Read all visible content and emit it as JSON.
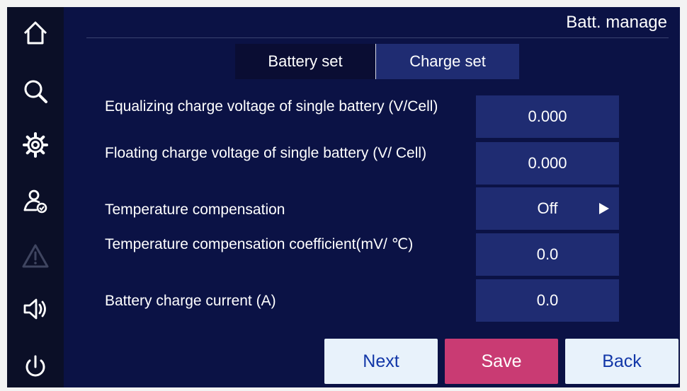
{
  "header": {
    "title": "Batt. manage"
  },
  "tabs": [
    {
      "label": "Battery set"
    },
    {
      "label": "Charge set"
    }
  ],
  "rows": [
    {
      "label": "Equalizing charge voltage of single battery (V/Cell)",
      "value": "0.000"
    },
    {
      "label": "Floating charge voltage of single battery (V/ Cell)",
      "value": "0.000"
    },
    {
      "label": "Temperature compensation",
      "value": "Off"
    },
    {
      "label": "Temperature compensation coefficient(mV/ ℃)",
      "value": "0.0"
    },
    {
      "label": "Battery charge current (A)",
      "value": "0.0"
    }
  ],
  "buttons": {
    "next": "Next",
    "save": "Save",
    "back": "Back"
  },
  "sidebar": {
    "icons": [
      "home-icon",
      "search-icon",
      "gear-icon",
      "user-check-icon",
      "warning-icon",
      "speaker-icon",
      "power-icon"
    ]
  },
  "colors": {
    "background": "#0b1245",
    "sidebar": "#0b0f27",
    "value_box": "#1f2c72",
    "save_button": "#c93b73",
    "light_button": "#e8f2fb",
    "button_text": "#1237a8",
    "disabled_icon": "#3f4560"
  }
}
